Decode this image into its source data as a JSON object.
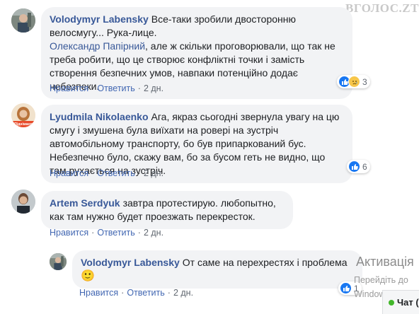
{
  "site": {
    "watermark": "ВГОЛОС.ZT"
  },
  "actions": {
    "like": "Нравится",
    "reply": "Ответить",
    "sep": "·"
  },
  "comments": [
    {
      "author": "Volodymyr Labensky",
      "text_a": "Все-таки зробили двосторонню велосмугу... Рука-лице.",
      "mention": "Олександр Папірний",
      "text_b": ", але ж скільки проговорювали, що так не треба робити, що це створює конфліктні точки і замість створення безпечних умов, навпаки потенційно додає небезпеки.",
      "time": "2 дн.",
      "reactions": {
        "count": "3",
        "icons": [
          "like-icon",
          "sad-icon"
        ]
      }
    },
    {
      "author": "Lyudmila Nikolaenko",
      "avatar_text": "Пiднiмаєм",
      "text": "Ага, якраз сьогодні звернула увагу на цю смугу і змушена була виїхати на ровері на зустріч автомобільному транспорту, бо був припаркований бус. Небезпечно було, скажу вам, бо за бусом геть не видно, що там рухається на зустріч.",
      "time": "2 дн.",
      "reactions": {
        "count": "6",
        "icons": [
          "like-icon"
        ]
      }
    },
    {
      "author": "Artem Serdyuk",
      "text": "завтра протестирую. любопытно, как там нужно будет проезжать перекресток.",
      "time": "2 дн."
    },
    {
      "author": "Volodymyr Labensky",
      "text": "От саме на перехрестях і проблема",
      "emoji": "🙂",
      "time": "2 дн.",
      "reactions": {
        "count": "1",
        "icons": [
          "like-icon"
        ]
      }
    }
  ],
  "windows": {
    "activate": "Активація",
    "line1": "Перейдіть до",
    "line2": "Windows."
  },
  "chat": {
    "label": "Чат ("
  },
  "colors": {
    "link": "#385898",
    "bubble": "#f2f3f5",
    "like": "#1877f2"
  }
}
